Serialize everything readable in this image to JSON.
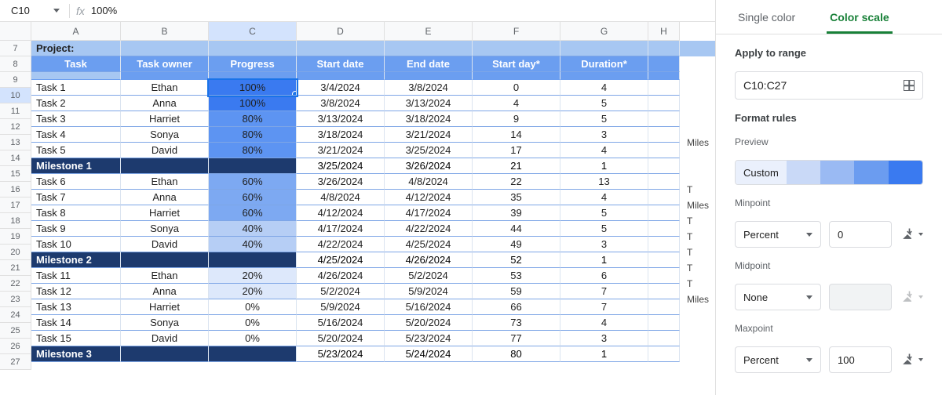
{
  "formula_bar": {
    "cell_ref": "C10",
    "value": "100%"
  },
  "columns": [
    "A",
    "B",
    "C",
    "D",
    "E",
    "F",
    "G",
    "H"
  ],
  "row_numbers": [
    7,
    8,
    9,
    10,
    11,
    12,
    13,
    14,
    15,
    16,
    17,
    18,
    19,
    20,
    21,
    22,
    23,
    24,
    25,
    26,
    27
  ],
  "active_cell": {
    "row": 10,
    "col": "C"
  },
  "selected_col": "C",
  "project_label": "Project:",
  "headers": {
    "task": "Task",
    "owner": "Task owner",
    "progress": "Progress",
    "start": "Start date",
    "end": "End date",
    "startday": "Start day*",
    "duration": "Duration*"
  },
  "tasks": [
    {
      "name": "Task 1",
      "owner": "Ethan",
      "progress": "100%",
      "start": "3/4/2024",
      "end": "3/8/2024",
      "startday": "0",
      "duration": "4",
      "shade": "p100"
    },
    {
      "name": "Task 2",
      "owner": "Anna",
      "progress": "100%",
      "start": "3/8/2024",
      "end": "3/13/2024",
      "startday": "4",
      "duration": "5",
      "shade": "p100"
    },
    {
      "name": "Task 3",
      "owner": "Harriet",
      "progress": "80%",
      "start": "3/13/2024",
      "end": "3/18/2024",
      "startday": "9",
      "duration": "5",
      "shade": "p80"
    },
    {
      "name": "Task 4",
      "owner": "Sonya",
      "progress": "80%",
      "start": "3/18/2024",
      "end": "3/21/2024",
      "startday": "14",
      "duration": "3",
      "shade": "p80"
    },
    {
      "name": "Task 5",
      "owner": "David",
      "progress": "80%",
      "start": "3/21/2024",
      "end": "3/25/2024",
      "startday": "17",
      "duration": "4",
      "shade": "p80"
    },
    {
      "milestone": "Milestone 1",
      "start": "3/25/2024",
      "end": "3/26/2024",
      "startday": "21",
      "duration": "1"
    },
    {
      "name": "Task 6",
      "owner": "Ethan",
      "progress": "60%",
      "start": "3/26/2024",
      "end": "4/8/2024",
      "startday": "22",
      "duration": "13",
      "shade": "p60"
    },
    {
      "name": "Task 7",
      "owner": "Anna",
      "progress": "60%",
      "start": "4/8/2024",
      "end": "4/12/2024",
      "startday": "35",
      "duration": "4",
      "shade": "p60"
    },
    {
      "name": "Task 8",
      "owner": "Harriet",
      "progress": "60%",
      "start": "4/12/2024",
      "end": "4/17/2024",
      "startday": "39",
      "duration": "5",
      "shade": "p60"
    },
    {
      "name": "Task 9",
      "owner": "Sonya",
      "progress": "40%",
      "start": "4/17/2024",
      "end": "4/22/2024",
      "startday": "44",
      "duration": "5",
      "shade": "p40"
    },
    {
      "name": "Task 10",
      "owner": "David",
      "progress": "40%",
      "start": "4/22/2024",
      "end": "4/25/2024",
      "startday": "49",
      "duration": "3",
      "shade": "p40"
    },
    {
      "milestone": "Milestone 2",
      "start": "4/25/2024",
      "end": "4/26/2024",
      "startday": "52",
      "duration": "1"
    },
    {
      "name": "Task 11",
      "owner": "Ethan",
      "progress": "20%",
      "start": "4/26/2024",
      "end": "5/2/2024",
      "startday": "53",
      "duration": "6",
      "shade": "p20"
    },
    {
      "name": "Task 12",
      "owner": "Anna",
      "progress": "20%",
      "start": "5/2/2024",
      "end": "5/9/2024",
      "startday": "59",
      "duration": "7",
      "shade": "p20"
    },
    {
      "name": "Task 13",
      "owner": "Harriet",
      "progress": "0%",
      "start": "5/9/2024",
      "end": "5/16/2024",
      "startday": "66",
      "duration": "7",
      "shade": "p0"
    },
    {
      "name": "Task 14",
      "owner": "Sonya",
      "progress": "0%",
      "start": "5/16/2024",
      "end": "5/20/2024",
      "startday": "73",
      "duration": "4",
      "shade": "p0"
    },
    {
      "name": "Task 15",
      "owner": "David",
      "progress": "0%",
      "start": "5/20/2024",
      "end": "5/23/2024",
      "startday": "77",
      "duration": "3",
      "shade": "p0"
    },
    {
      "milestone": "Milestone 3",
      "start": "5/23/2024",
      "end": "5/24/2024",
      "startday": "80",
      "duration": "1"
    }
  ],
  "overflow_col": [
    "",
    "",
    "",
    "",
    "",
    "",
    "Miles",
    "",
    "",
    "T",
    "Miles",
    "T",
    "T",
    "T",
    "T",
    "T",
    "Miles",
    "",
    "",
    "",
    ""
  ],
  "panel": {
    "tabs": {
      "single": "Single color",
      "scale": "Color scale"
    },
    "apply_label": "Apply to range",
    "range_value": "C10:C27",
    "rules_label": "Format rules",
    "preview_label": "Preview",
    "preview_text": "Custom",
    "minpoint_label": "Minpoint",
    "min_type": "Percent",
    "min_value": "0",
    "midpoint_label": "Midpoint",
    "mid_type": "None",
    "maxpoint_label": "Maxpoint",
    "max_type": "Percent",
    "max_value": "100"
  },
  "chart_data": {
    "type": "table",
    "title": "Project task list with color-scale conditional formatting on Progress",
    "columns": [
      "Task",
      "Task owner",
      "Progress",
      "Start date",
      "End date",
      "Start day*",
      "Duration*"
    ],
    "rows": [
      [
        "Task 1",
        "Ethan",
        "100%",
        "3/4/2024",
        "3/8/2024",
        0,
        4
      ],
      [
        "Task 2",
        "Anna",
        "100%",
        "3/8/2024",
        "3/13/2024",
        4,
        5
      ],
      [
        "Task 3",
        "Harriet",
        "80%",
        "3/13/2024",
        "3/18/2024",
        9,
        5
      ],
      [
        "Task 4",
        "Sonya",
        "80%",
        "3/18/2024",
        "3/21/2024",
        14,
        3
      ],
      [
        "Task 5",
        "David",
        "80%",
        "3/21/2024",
        "3/25/2024",
        17,
        4
      ],
      [
        "Milestone 1",
        "",
        "",
        "3/25/2024",
        "3/26/2024",
        21,
        1
      ],
      [
        "Task 6",
        "Ethan",
        "60%",
        "3/26/2024",
        "4/8/2024",
        22,
        13
      ],
      [
        "Task 7",
        "Anna",
        "60%",
        "4/8/2024",
        "4/12/2024",
        35,
        4
      ],
      [
        "Task 8",
        "Harriet",
        "60%",
        "4/12/2024",
        "4/17/2024",
        39,
        5
      ],
      [
        "Task 9",
        "Sonya",
        "40%",
        "4/17/2024",
        "4/22/2024",
        44,
        5
      ],
      [
        "Task 10",
        "David",
        "40%",
        "4/22/2024",
        "4/25/2024",
        49,
        3
      ],
      [
        "Milestone 2",
        "",
        "",
        "4/25/2024",
        "4/26/2024",
        52,
        1
      ],
      [
        "Task 11",
        "Ethan",
        "20%",
        "4/26/2024",
        "5/2/2024",
        53,
        6
      ],
      [
        "Task 12",
        "Anna",
        "20%",
        "5/2/2024",
        "5/9/2024",
        59,
        7
      ],
      [
        "Task 13",
        "Harriet",
        "0%",
        "5/9/2024",
        "5/16/2024",
        66,
        7
      ],
      [
        "Task 14",
        "Sonya",
        "0%",
        "5/16/2024",
        "5/20/2024",
        73,
        4
      ],
      [
        "Task 15",
        "David",
        "0%",
        "5/20/2024",
        "5/23/2024",
        77,
        3
      ],
      [
        "Milestone 3",
        "",
        "",
        "5/23/2024",
        "5/24/2024",
        80,
        1
      ]
    ],
    "color_scale": {
      "column": "Progress",
      "min_percent": 0,
      "max_percent": 100,
      "min_color": "#ffffff",
      "max_color": "#3a7af0"
    }
  }
}
